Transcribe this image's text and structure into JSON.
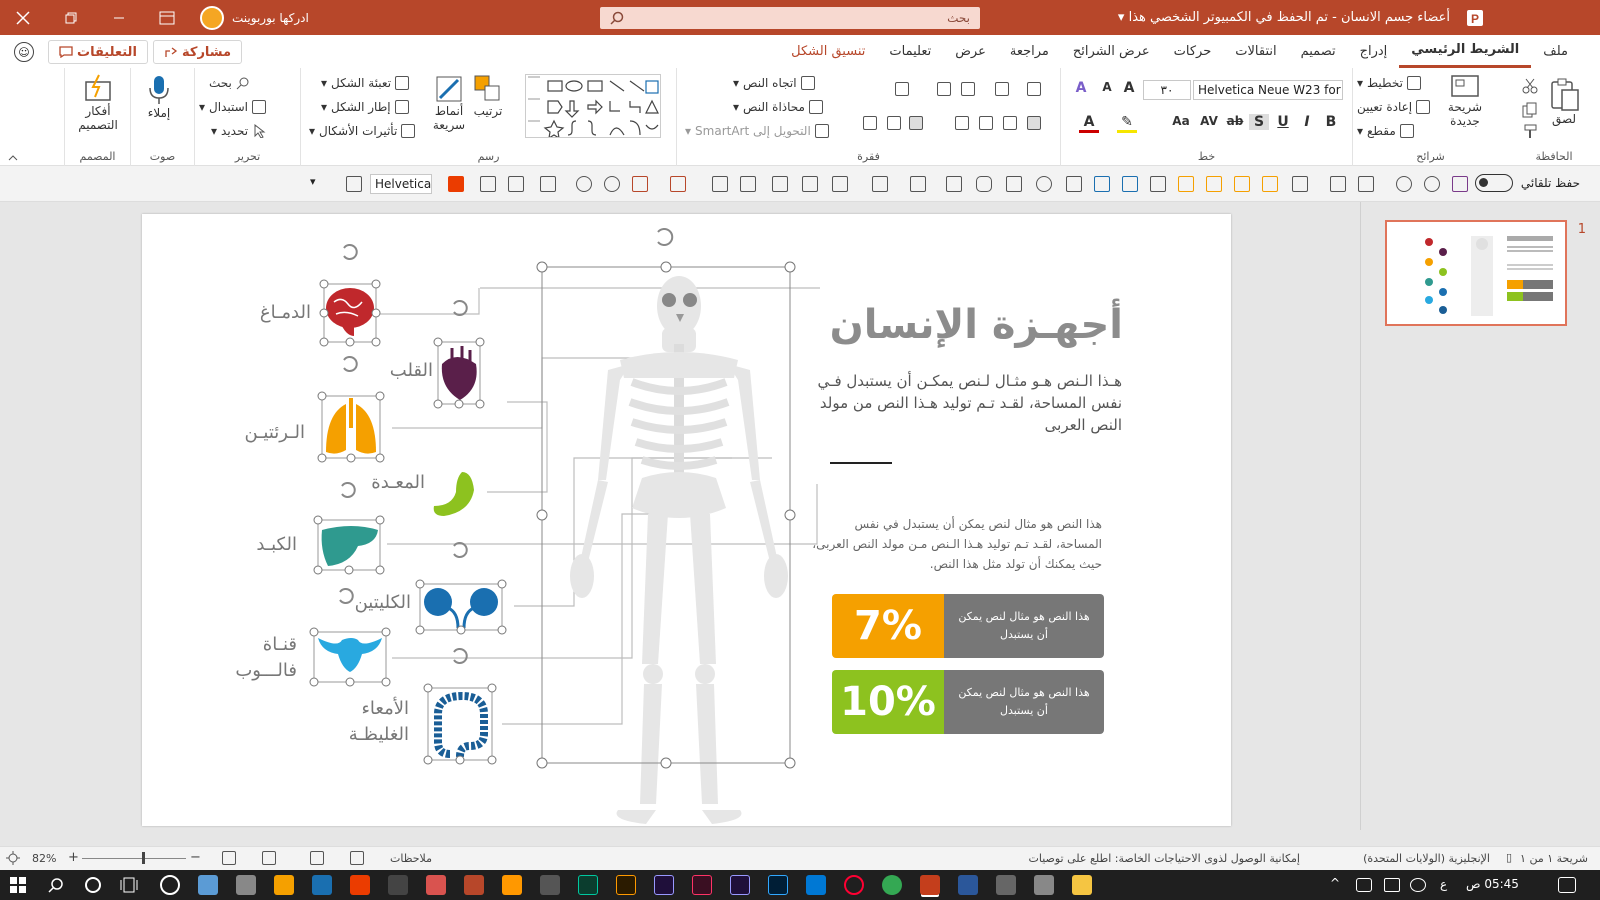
{
  "window": {
    "title": "أعضاء جسم الانسان  -  تم الحفظ في الكمبيوتر الشخصي هذا ▾",
    "search_placeholder": "بحث",
    "account_name": "ادركها بوربوينت"
  },
  "ribbon_tabs": [
    "ملف",
    "الشريط الرئيسي",
    "إدراج",
    "تصميم",
    "انتقالات",
    "حركات",
    "عرض الشرائح",
    "مراجعة",
    "عرض",
    "تعليمات",
    "تنسيق الشكل"
  ],
  "share_label": "مشاركة",
  "comments_label": "التعليقات",
  "ribbon": {
    "clipboard": {
      "label": "الحافظة",
      "paste": "لصق"
    },
    "slides": {
      "label": "شرائح",
      "new_slide": "شريحة جديدة",
      "layout": "تخطيط",
      "reset": "إعادة تعيين",
      "section": "مقطع"
    },
    "font": {
      "label": "خط",
      "font_name": "Helvetica Neue W23 for S",
      "font_size": "٣٠"
    },
    "paragraph": {
      "label": "فقرة",
      "text_direction": "اتجاه النص",
      "align_text": "محاذاة النص",
      "convert_smartart": "التحويل إلى SmartArt"
    },
    "drawing": {
      "label": "رسم",
      "arrange": "ترتيب",
      "quick_styles": "أنماط سريعة",
      "shape_fill": "تعبئة الشكل",
      "shape_outline": "إطار الشكل",
      "shape_effects": "تأثيرات الأشكال"
    },
    "editing": {
      "label": "تحرير",
      "find": "بحث",
      "replace": "استبدال",
      "select": "تحديد"
    },
    "voice": {
      "label": "صوت",
      "dictate": "إملاء"
    },
    "designer": {
      "label": "المصمم",
      "design_ideas": "أفكار التصميم"
    }
  },
  "qat": {
    "autosave": "حفظ تلقائي",
    "font_box": "Helvetica"
  },
  "slide": {
    "title": "أجهـزة الإنسان",
    "body1": "هـذا الـنص هـو مثـال لـنص يمكـن أن يستبدل فـي نفس المساحة، لقـد تـم توليد هـذا النص من مولد النص العربى",
    "body2": "هذا النص هو مثال لنص يمكن أن يستبدل في نفس المساحة، لقـد تـم توليد هـذا الـنص مـن مولد النص العربى، حيث يمكنك أن تولد مثل هذا النص.",
    "stats": [
      {
        "value": "7%",
        "text": "هذا النص هو مثال لنص يمكن أن يستبدل",
        "color": "#f5a000"
      },
      {
        "value": "10%",
        "text": "هذا النص هو مثال لنص يمكن أن يستبدل",
        "color": "#8dc21f"
      }
    ],
    "organs": {
      "brain": "الدمـاغ",
      "heart": "القلب",
      "lungs": "الـرئتيـن",
      "stomach": "المعـدة",
      "liver": "الكبـد",
      "kidneys": "الكليتين",
      "fallopian": "قنـاة فالـــوب",
      "colon": "الأمعاء الغليظـة"
    },
    "organ_colors": {
      "brain": "#c0282c",
      "heart": "#5a1f4a",
      "lungs": "#f5a000",
      "stomach": "#8dc21f",
      "liver": "#2f9a8f",
      "kidneys": "#1a6fb0",
      "fallopian": "#29a9e0",
      "colon": "#1a5e96"
    }
  },
  "status": {
    "slide_info": "شريحة ١ من ١",
    "language": "الإنجليزية (الولايات المتحدة)",
    "accessibility": "إمكانية الوصول لذوى الاحتياجات الخاصة: اطلع على توصيات",
    "notes": "ملاحظات",
    "zoom": "82%"
  },
  "taskbar": {
    "time": "05:45 ص",
    "lang": "ع"
  },
  "thumbnail_number": "1"
}
